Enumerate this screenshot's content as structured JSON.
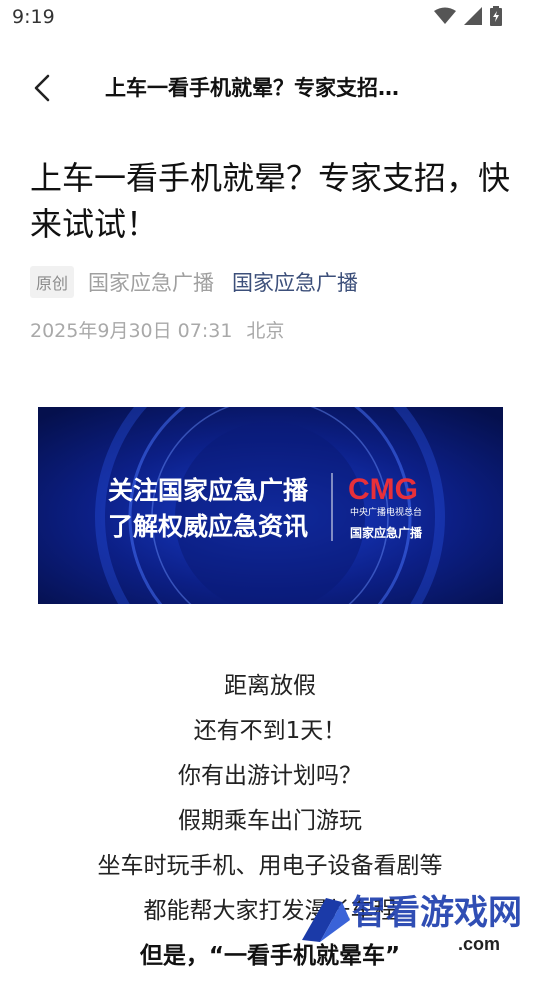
{
  "status": {
    "time": "9:19"
  },
  "nav": {
    "title": "上车一看手机就晕？专家支招…"
  },
  "article": {
    "title": "上车一看手机就晕？专家支招，快来试试！",
    "badge": "原创",
    "author": "国家应急广播",
    "account": "国家应急广播",
    "date": "2025年9月30日 07:31",
    "location": "北京",
    "banner": {
      "line1": "关注国家应急广播",
      "line2": "了解权威应急资讯",
      "brand": "CMG",
      "brand_sub": "中央广播电视总台",
      "brand_tag": "国家应急广播",
      "colors": {
        "bg": "#0c1f86",
        "brand_red": "#e8303a"
      }
    },
    "paragraphs": [
      "距离放假",
      "还有不到1天！",
      "你有出游计划吗？",
      "假期乘车出门游玩",
      "坐车时玩手机、用电子设备看剧等",
      "都能帮大家打发漫长车程",
      "但是，“一看手机就晕车”"
    ]
  },
  "watermark": {
    "text": "智看游戏网",
    "url": ".com"
  }
}
